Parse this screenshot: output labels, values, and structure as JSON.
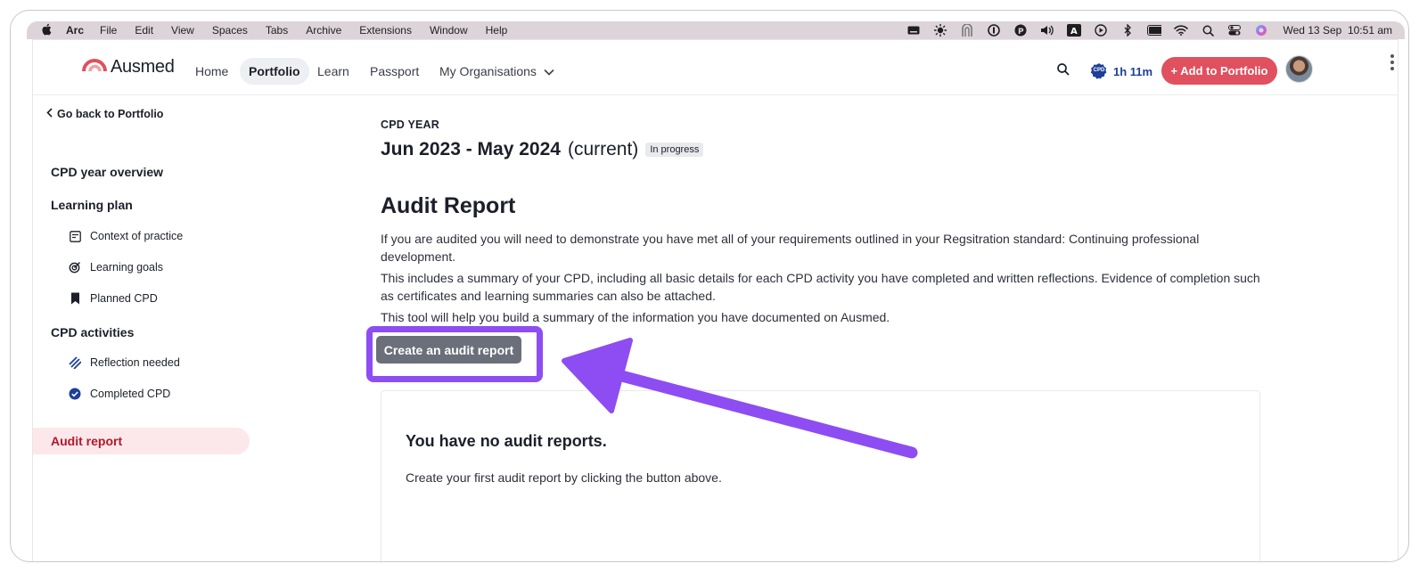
{
  "menubar": {
    "app_name": "Arc",
    "items": [
      "File",
      "Edit",
      "View",
      "Spaces",
      "Tabs",
      "Archive",
      "Extensions",
      "Window",
      "Help"
    ],
    "clock": "Wed 13 Sep  10:51 am"
  },
  "nav": {
    "logo_text": "Ausmed",
    "home": "Home",
    "portfolio": "Portfolio",
    "learn": "Learn",
    "passport": "Passport",
    "my_organisations": "My Organisations",
    "cpd_badge": "CPD",
    "cpd_time": "1h 11m",
    "add_button": "+ Add to Portfolio"
  },
  "sidebar": {
    "back": "Go back to Portfolio",
    "overview": "CPD year overview",
    "learning_plan": "Learning plan",
    "context": "Context of practice",
    "goals": "Learning goals",
    "planned": "Planned CPD",
    "activities": "CPD activities",
    "reflection": "Reflection needed",
    "completed": "Completed CPD",
    "audit": "Audit report"
  },
  "main": {
    "cpd_year_label": "CPD YEAR",
    "year_range": "Jun 2023 - May 2024",
    "year_current": "(current)",
    "status_badge": "In progress",
    "title": "Audit Report",
    "para1": "If you are audited you will need to demonstrate you have met all of your requirements outlined in your Regsitration standard: Continuing professional development.",
    "para2": "This includes a summary of your CPD, including all basic details for each CPD activity you have completed and written reflections. Evidence of completion such as certificates and learning summaries can also be attached.",
    "para3": "This tool will help you build a summary of the information you have documented on Ausmed.",
    "create_button": "Create an audit report",
    "empty_title": "You have no audit reports.",
    "empty_sub": "Create your first audit report by clicking the button above."
  },
  "colors": {
    "brand_red": "#e0505e",
    "active_red": "#b3182a",
    "annotation_purple": "#8d4df2",
    "cpd_blue": "#1d3f96"
  }
}
